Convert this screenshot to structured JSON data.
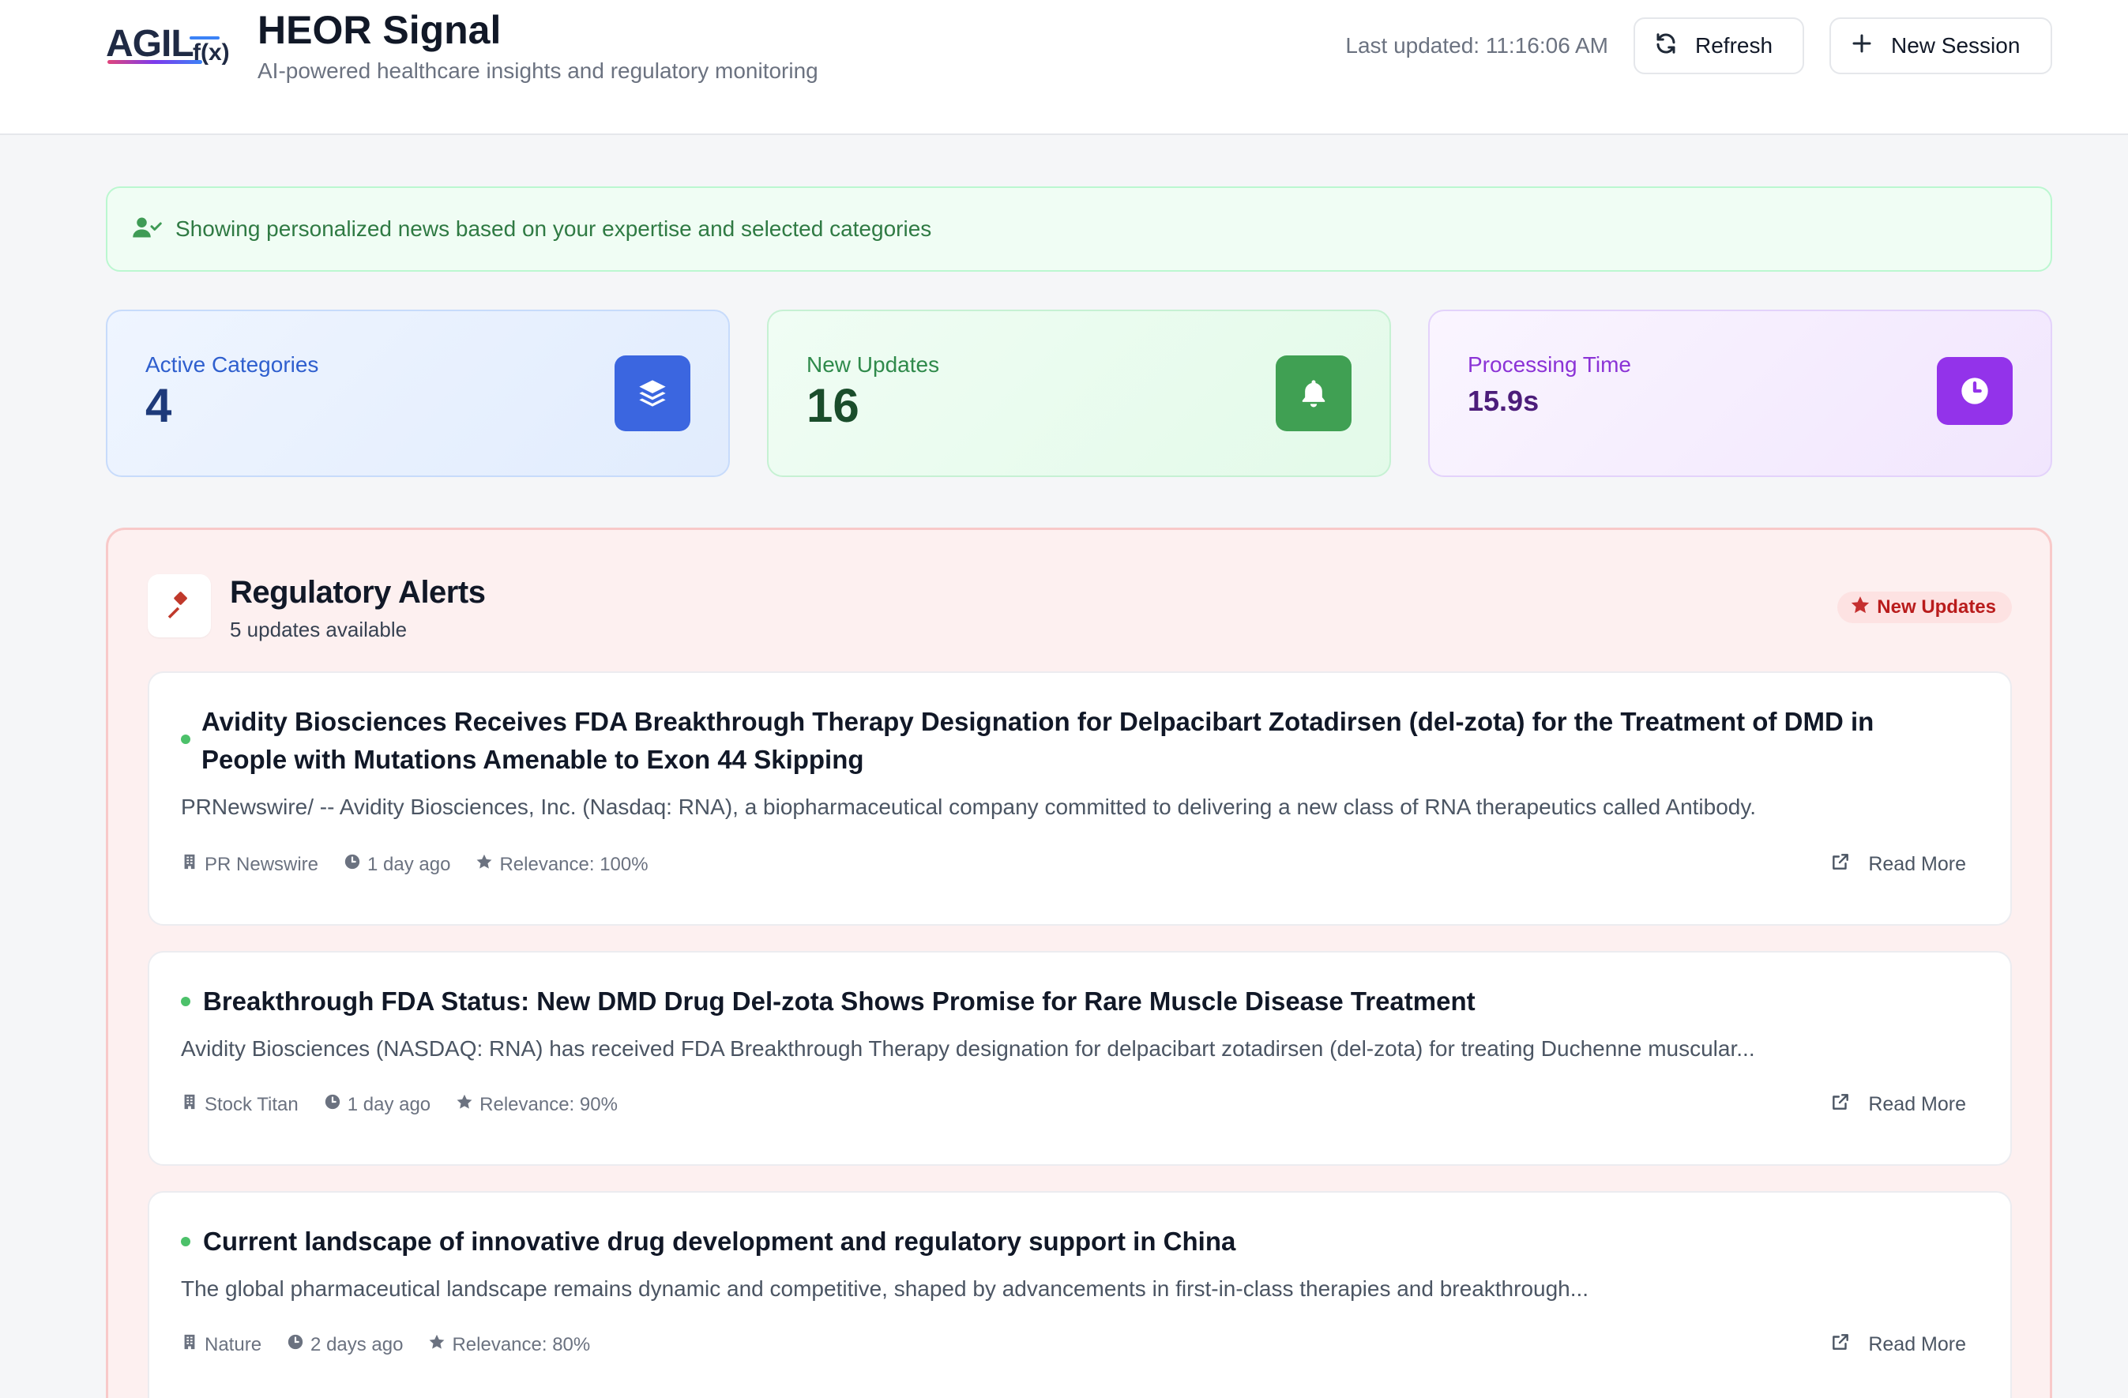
{
  "header": {
    "logo_text": "AGIL",
    "logo_fx": "f(x)",
    "title": "HEOR Signal",
    "subtitle": "AI-powered healthcare insights and regulatory monitoring",
    "last_updated": "Last updated: 11:16:06 AM",
    "refresh_label": "Refresh",
    "new_session_label": "New Session"
  },
  "banner": {
    "text": "Showing personalized news based on your expertise and selected categories"
  },
  "stats": [
    {
      "label": "Active Categories",
      "value": "4",
      "icon": "layers-icon",
      "color": "#3b66e0"
    },
    {
      "label": "New Updates",
      "value": "16",
      "icon": "bell-icon",
      "color": "#40a053"
    },
    {
      "label": "Processing Time",
      "value": "15.9s",
      "icon": "clock-icon",
      "color": "#9333ea"
    }
  ],
  "alerts": {
    "title": "Regulatory Alerts",
    "count": "5 updates available",
    "badge": "New Updates",
    "read_more": "Read More",
    "items": [
      {
        "title": "Avidity Biosciences Receives FDA Breakthrough Therapy Designation for Delpacibart Zotadirsen (del-zota) for the Treatment of DMD in People with Mutations Amenable to Exon 44 Skipping",
        "desc": "PRNewswire/ -- Avidity Biosciences, Inc. (Nasdaq: RNA), a biopharmaceutical company committed to delivering a new class of RNA therapeutics called Antibody.",
        "source": "PR Newswire",
        "time": "1 day ago",
        "relevance": "Relevance: 100%"
      },
      {
        "title": "Breakthrough FDA Status: New DMD Drug Del-zota Shows Promise for Rare Muscle Disease Treatment",
        "desc": "Avidity Biosciences (NASDAQ: RNA) has received FDA Breakthrough Therapy designation for delpacibart zotadirsen (del-zota) for treating Duchenne muscular...",
        "source": "Stock Titan",
        "time": "1 day ago",
        "relevance": "Relevance: 90%"
      },
      {
        "title": "Current landscape of innovative drug development and regulatory support in China",
        "desc": "The global pharmaceutical landscape remains dynamic and competitive, shaped by advancements in first-in-class therapies and breakthrough...",
        "source": "Nature",
        "time": "2 days ago",
        "relevance": "Relevance: 80%"
      }
    ]
  }
}
